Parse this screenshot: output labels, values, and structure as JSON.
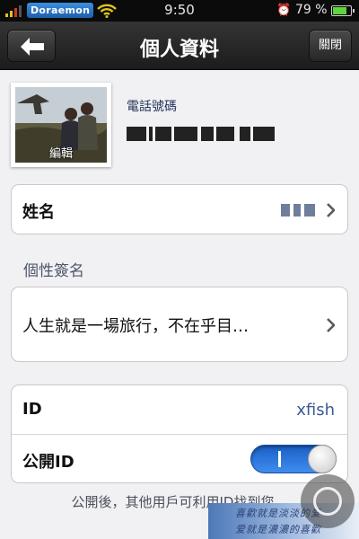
{
  "status_bar": {
    "carrier": "Doraemon",
    "time": "9:50",
    "battery": "79 %",
    "battery_level": 0.79
  },
  "nav_bar": {
    "title": "個人資料",
    "back_icon": "left-arrow-icon",
    "close_label": "關閉"
  },
  "profile": {
    "edit_label": "編輯",
    "phone_label": "電話號碼"
  },
  "name_row": {
    "label": "姓名"
  },
  "signature_section": {
    "heading": "個性簽名",
    "text": "人生就是一場旅行，不在乎目…"
  },
  "id_group": {
    "id_label": "ID",
    "id_value": "xfish",
    "public_label": "公開ID",
    "public_enabled": true
  },
  "footer_note": "公開後，其他用戶可利用ID找到您。",
  "watermark": {
    "line1": "喜歡就是淡淡的爱",
    "line2": "爱就是濃濃的喜歡"
  },
  "colors": {
    "accent": "#2f7ae5",
    "nav_bar": "#242424",
    "background": "#f1f1f3"
  }
}
